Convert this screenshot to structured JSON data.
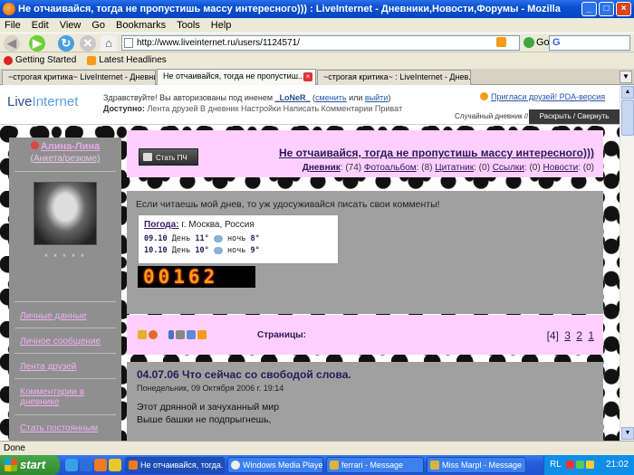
{
  "window": {
    "title": "Не отчаивайся, тогда не пропустишь массу интересного))) : LiveInternet - Дневники,Новости,Форумы - Mozilla Firefox",
    "btn_min": "_",
    "btn_max": "□",
    "btn_close": "×"
  },
  "menu": [
    "File",
    "Edit",
    "View",
    "Go",
    "Bookmarks",
    "Tools",
    "Help"
  ],
  "nav": {
    "url": "http://www.liveinternet.ru/users/1124571/",
    "go_label": "Go",
    "search_value": "G"
  },
  "bookmarks": [
    {
      "label": "Getting Started",
      "icon": "firefox-red-icon"
    },
    {
      "label": "Latest Headlines",
      "icon": "rss-icon"
    }
  ],
  "tabs": [
    {
      "label": "~строгая критика~ LiveInternet - Дневни..."
    },
    {
      "label": "Не отчаивайся, тогда не пропустиш..."
    },
    {
      "label": "~строгая критика~ : LiveInternet - Днев..."
    }
  ],
  "li_header": {
    "logo_live": "Live",
    "logo_internet": "Internet",
    "greet_prefix": "Здравствуйте! Вы авторизованы под иненем",
    "username": "_LoNeR_",
    "change_link": "сменить",
    "or_text": "или",
    "logout_link": "выйти",
    "access_label": "Доступно:",
    "access_items": "Лента друзей В дневник Настройки Написать Комментарии Привaт",
    "invite_links": "Пригласи друзей! PDA-версия",
    "random_diary": "Случайный дневник //",
    "expand_collapse": "Раскрыть / Свернуть"
  },
  "sidebar": {
    "name": "Алина-Лина",
    "anketa": "(Анкета/резюме)",
    "stars": "* * * * *",
    "links": [
      "Личные данные",
      "Личное сообщение",
      "Лента друзей",
      "Комментарии в дневнике",
      "Стать постоянным"
    ]
  },
  "diary": {
    "button_label": "Стать ПЧ",
    "title": "Не отчаивайся, тогда не пропустишь массу интересного)))",
    "stats": {
      "diary_label": "Дневник",
      "diary_count": "(74)",
      "photo_label": "Фотоальбом",
      "photo_count": "(8)",
      "quotes_label": "Цитатник",
      "quotes_count": "(0)",
      "links_label": "Ссылки",
      "links_count": "(0)",
      "news_label": "Новости",
      "news_count": "(0)"
    }
  },
  "intro": {
    "text": "Если читаешь мой днев, то уж удосуживайся писать свои комменты!",
    "weather_label": "Погода:",
    "weather_city": "г. Москва, Россия",
    "rows": [
      {
        "date": "09.10",
        "day_label": "День",
        "day_temp": "11°",
        "night_label": "ночь",
        "night_temp": "8°"
      },
      {
        "date": "10.10",
        "day_label": "День",
        "day_temp": "10°",
        "night_label": "ночь",
        "night_temp": "9°"
      }
    ],
    "counter": "00162"
  },
  "pager": {
    "pages_label": "Страницы:",
    "current": "[4]",
    "pages": [
      "3",
      "2",
      "1"
    ]
  },
  "post": {
    "title": "04.07.06 Что сейчас со свободой слова.",
    "date": "Понедельник, 09 Октября 2006 г. 19:14",
    "lines": [
      "Этот дрянной и зачуханный мир",
      "Выше башки не подпрыгнешь,"
    ]
  },
  "status": "Done",
  "taskbar": {
    "start": "start",
    "tasks": [
      "Не отчаивайся, тогда...",
      "Windows Media Player",
      "ferrari - Message",
      "Miss Marpl - Message"
    ],
    "lang": "RL",
    "clock": "21:02"
  }
}
